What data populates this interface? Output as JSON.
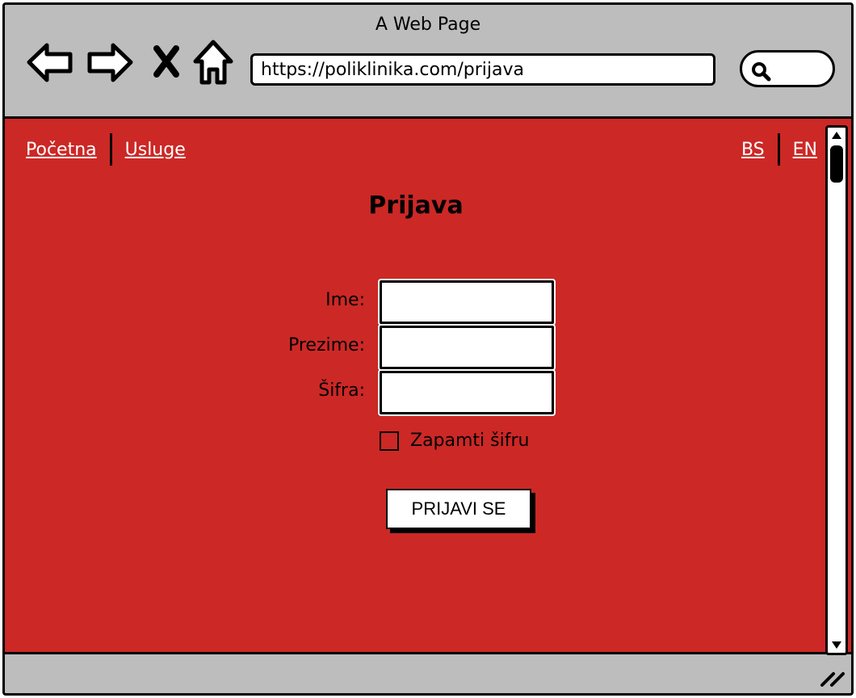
{
  "window": {
    "title": "A Web Page"
  },
  "browser": {
    "url": "https://poliklinika.com/prijava",
    "icons": [
      "back-arrow-icon",
      "forward-arrow-icon",
      "stop-icon",
      "home-icon",
      "search-icon"
    ]
  },
  "nav": {
    "items": [
      {
        "label": "Početna"
      },
      {
        "label": "Usluge"
      }
    ]
  },
  "lang": {
    "items": [
      {
        "label": "BS"
      },
      {
        "label": "EN"
      }
    ]
  },
  "page": {
    "title": "Prijava"
  },
  "form": {
    "fields": [
      {
        "label": "Ime:",
        "value": ""
      },
      {
        "label": "Prezime:",
        "value": ""
      },
      {
        "label": "Šifra:",
        "value": ""
      }
    ],
    "remember_label": "Zapamti šifru",
    "remember_checked": false,
    "submit_label": "PRIJAVI SE"
  },
  "colors": {
    "page_background": "#cc2826",
    "chrome_background": "#bdbdbd",
    "link": "#ffffff"
  }
}
